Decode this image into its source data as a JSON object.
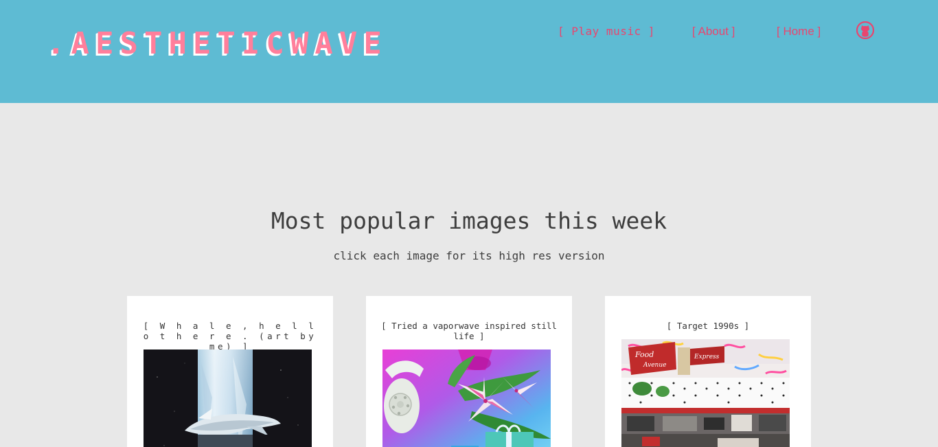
{
  "header": {
    "logo": ".AESTHETICWAVE",
    "nav": {
      "play_music": "[ Play music ]",
      "about": "[ About ]",
      "home": "[ Home ]"
    },
    "github_icon": "github-icon"
  },
  "main": {
    "title": "Most popular images this week",
    "subtitle": "click each image for its high res version"
  },
  "cards": [
    {
      "caption": "[ W h a l e , h e l l o t h e r e . (art by me) ]"
    },
    {
      "caption": "[ Tried a vaporwave inspired still life ]"
    },
    {
      "caption": "[ Target 1990s ]"
    }
  ],
  "colors": {
    "header_bg": "#5ebbd3",
    "accent_pink": "#ff7f9b",
    "nav_pink": "#e8466f",
    "page_bg": "#e8e8e8"
  }
}
